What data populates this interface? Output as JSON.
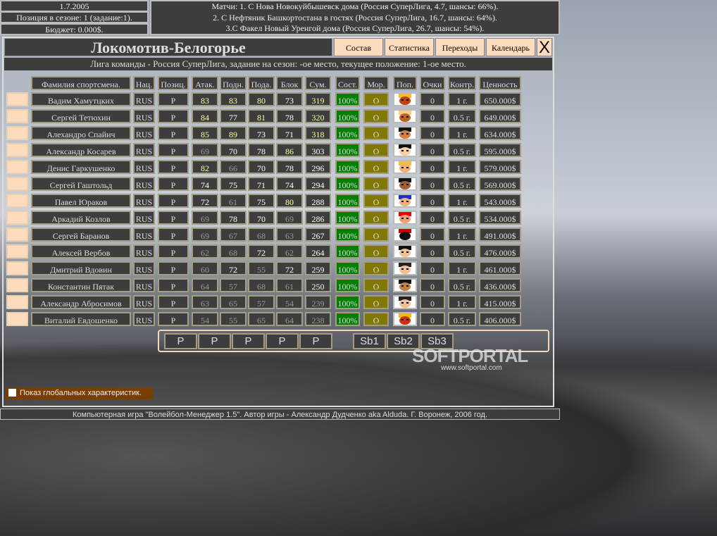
{
  "top": {
    "date": "1.7.2005",
    "position": "Позиция в сезоне: 1 (задание:1).",
    "budget": "Бюджет: 0.000$.",
    "matches": [
      "Матчи: 1. С Нова Новокуйбышевск дома (Россия СуперЛига, 4.7, шансы: 66%).",
      "2. С Нефтяник Башкортостана в гостях (Россия СуперЛига, 16.7, шансы: 64%).",
      "3.С Факел Новый Уренгой дома (Россия СуперЛига, 26.7, шансы: 54%)."
    ]
  },
  "team": {
    "name": "Локомотив-Белогорье",
    "league_info": "Лига команды - Россия СуперЛига, задание на сезон: -ое место, текущее положение: 1-ое место."
  },
  "nav": [
    "Состав",
    "Статистика",
    "Переходы",
    "Календарь"
  ],
  "close_label": "X",
  "columns": [
    "Фамилия спортсмена.",
    "Нац.",
    "Позиц.",
    "Атак.",
    "Подн.",
    "Пода.",
    "Блок",
    "Сум.",
    "Сост.",
    "Мор.",
    "Поп.",
    "Очки",
    "Контр.",
    "Ценность"
  ],
  "players": [
    [
      "Вадим Хамутцких",
      "RUS",
      "Р",
      "83",
      "83",
      "80",
      "73",
      "319",
      "100%",
      "О",
      "0",
      "1 г.",
      "650.000$"
    ],
    [
      "Сергей Тетюхин",
      "RUS",
      "Р",
      "84",
      "77",
      "81",
      "78",
      "320",
      "100%",
      "О",
      "0",
      "0.5 г.",
      "649.000$"
    ],
    [
      "Алехандро Спайич",
      "RUS",
      "Р",
      "85",
      "89",
      "73",
      "71",
      "318",
      "100%",
      "О",
      "0",
      "1 г.",
      "634.000$"
    ],
    [
      "Александр Косарев",
      "RUS",
      "Р",
      "69",
      "70",
      "78",
      "86",
      "303",
      "100%",
      "О",
      "0",
      "0.5 г.",
      "595.000$"
    ],
    [
      "Денис Гаркушенко",
      "RUS",
      "Р",
      "82",
      "66",
      "70",
      "78",
      "296",
      "100%",
      "О",
      "0",
      "1 г.",
      "579.000$"
    ],
    [
      "Сергей Гаштольд",
      "RUS",
      "Р",
      "74",
      "75",
      "71",
      "74",
      "294",
      "100%",
      "О",
      "0",
      "0.5 г.",
      "569.000$"
    ],
    [
      "Павел Юраков",
      "RUS",
      "Р",
      "72",
      "61",
      "75",
      "80",
      "288",
      "100%",
      "О",
      "0",
      "1 г.",
      "543.000$"
    ],
    [
      "Аркадий Козлов",
      "RUS",
      "Р",
      "69",
      "78",
      "70",
      "69",
      "286",
      "100%",
      "О",
      "0",
      "0.5 г.",
      "534.000$"
    ],
    [
      "Сергей Баранов",
      "RUS",
      "Р",
      "69",
      "67",
      "68",
      "63",
      "267",
      "100%",
      "О",
      "0",
      "1 г.",
      "491.000$"
    ],
    [
      "Алексей Вербов",
      "RUS",
      "Р",
      "62",
      "68",
      "72",
      "62",
      "264",
      "100%",
      "О",
      "0",
      "0.5 г.",
      "476.000$"
    ],
    [
      "Дмитрий Вдовин",
      "RUS",
      "Р",
      "60",
      "72",
      "55",
      "72",
      "259",
      "100%",
      "О",
      "0",
      "1 г.",
      "461.000$"
    ],
    [
      "Константин Пятак",
      "RUS",
      "Р",
      "64",
      "57",
      "68",
      "61",
      "250",
      "100%",
      "О",
      "0",
      "0.5 г.",
      "436.000$"
    ],
    [
      "Александр Абросимов",
      "RUS",
      "Р",
      "63",
      "65",
      "57",
      "54",
      "239",
      "100%",
      "О",
      "0",
      "1 г.",
      "415.000$"
    ],
    [
      "Виталий Евдошенко",
      "RUS",
      "Р",
      "54",
      "55",
      "65",
      "64",
      "238",
      "100%",
      "О",
      "0",
      "0.5 г.",
      "406.000$"
    ]
  ],
  "lineup": {
    "starters": [
      "P",
      "P",
      "P",
      "P",
      "P"
    ],
    "subs": [
      "Sb1",
      "Sb2",
      "Sb3"
    ]
  },
  "global_toggle": {
    "label": "Показ глобальных характеристик.",
    "checked": false
  },
  "watermark": {
    "logo": "SOFTPORTAL",
    "url": "www.softportal.com"
  },
  "footer": "Компьютерная игра \"Волейбол-Менеджер 1.5\". Автор игры - Александр Дудченко aka Alduda. Г. Воронеж, 2006 год."
}
